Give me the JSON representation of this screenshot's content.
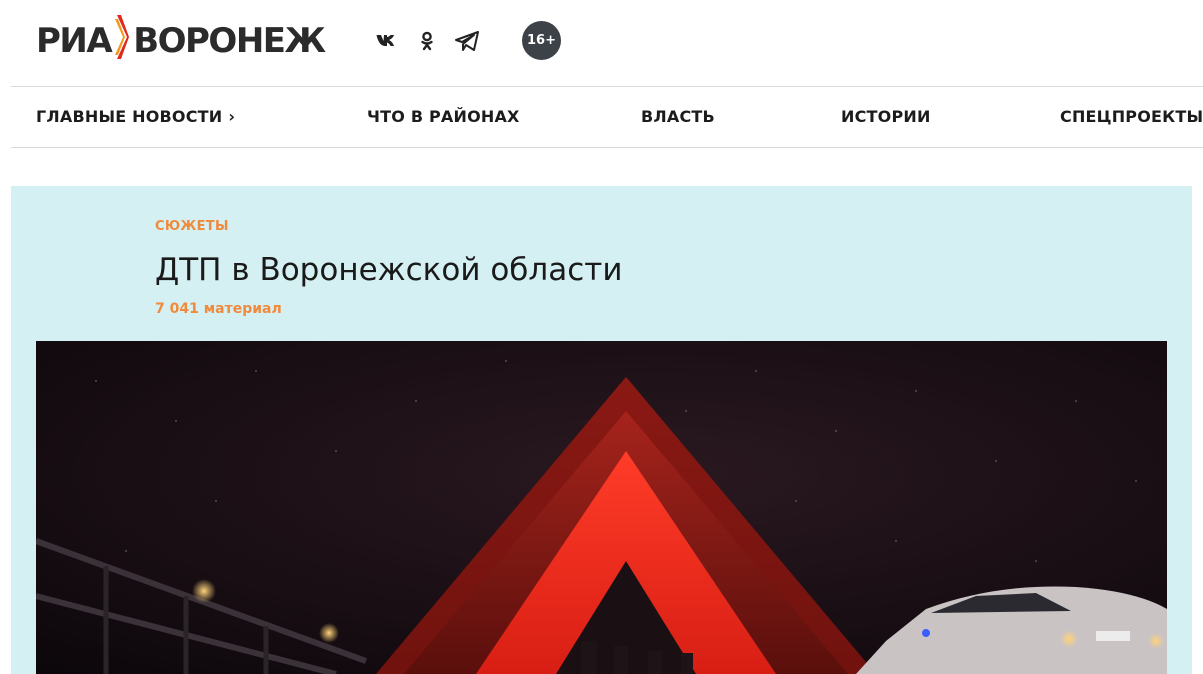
{
  "header": {
    "logo": {
      "left": "РИА",
      "right": "ВОРОНЕЖ"
    },
    "socials": [
      {
        "icon": "vk-icon",
        "label": "vk"
      },
      {
        "icon": "odnoklassniki-icon",
        "label": "ok"
      },
      {
        "icon": "telegram-icon",
        "label": "telegram"
      }
    ],
    "age_rating": "16+"
  },
  "nav": {
    "items": [
      {
        "label": "ГЛАВНЫЕ НОВОСТИ",
        "has_chevron": true
      },
      {
        "label": "ЧТО В РАЙОНАХ",
        "has_chevron": false
      },
      {
        "label": "ВЛАСТЬ",
        "has_chevron": false
      },
      {
        "label": "ИСТОРИИ",
        "has_chevron": false
      },
      {
        "label": "СПЕЦПРОЕКТЫ",
        "has_chevron": false
      }
    ]
  },
  "story": {
    "kicker": "СЮЖЕТЫ",
    "title": "ДТП в Воронежской области",
    "count": "7 041 материал"
  },
  "colors": {
    "accent": "#f08a3c",
    "logo_red": "#e0281e",
    "logo_orange": "#f39a1e",
    "story_bg": "#d4f0f2",
    "badge_bg": "#3d4248",
    "text": "#1c1c1c"
  }
}
